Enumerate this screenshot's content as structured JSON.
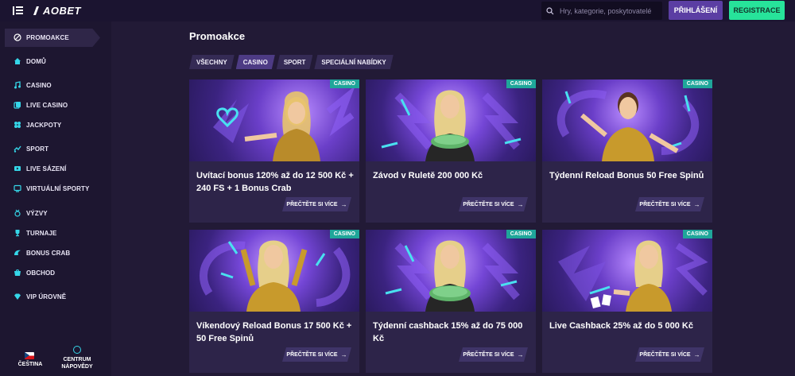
{
  "header": {
    "logo": "AOBET",
    "search_placeholder": "Hry, kategorie, poskytovatelé",
    "login_label": "PŘIHLÁŠENÍ",
    "register_label": "REGISTRACE"
  },
  "sidebar": {
    "items": [
      {
        "label": "PROMOAKCE",
        "icon": "promo-icon"
      },
      {
        "label": "DOMŮ",
        "icon": "home-icon"
      },
      {
        "label": "CASINO",
        "icon": "music-note-icon"
      },
      {
        "label": "LIVE CASINO",
        "icon": "live-casino-icon"
      },
      {
        "label": "JACKPOTY",
        "icon": "clover-icon"
      },
      {
        "label": "SPORT",
        "icon": "sport-icon"
      },
      {
        "label": "LIVE SÁZENÍ",
        "icon": "live-betting-icon"
      },
      {
        "label": "VIRTUÁLNÍ SPORTY",
        "icon": "virtual-sports-icon"
      },
      {
        "label": "VÝZVY",
        "icon": "medal-icon"
      },
      {
        "label": "TURNAJE",
        "icon": "trophy-icon"
      },
      {
        "label": "BONUS CRAB",
        "icon": "crab-icon"
      },
      {
        "label": "OBCHOD",
        "icon": "shop-icon"
      },
      {
        "label": "VIP ÚROVNĚ",
        "icon": "diamond-icon"
      }
    ],
    "language_label": "ČEŠTINA",
    "help_label_line1": "CENTRUM",
    "help_label_line2": "NÁPOVĚDY"
  },
  "main": {
    "title": "Promoakce",
    "tabs": [
      {
        "label": "VŠECHNY"
      },
      {
        "label": "CASINO"
      },
      {
        "label": "SPORT"
      },
      {
        "label": "SPECIÁLNÍ NABÍDKY"
      }
    ],
    "active_tab": "CASINO",
    "read_more_label": "PŘEČTĚTE SI VÍCE",
    "cards": [
      {
        "badge": "CASINO",
        "title": "Uvítací bonus 120% až do 12 500 Kč + 240 FS + 1 Bonus Crab"
      },
      {
        "badge": "CASINO",
        "title": "Závod v Ruletě 200 000 Kč"
      },
      {
        "badge": "CASINO",
        "title": "Týdenní Reload Bonus 50 Free Spinů"
      },
      {
        "badge": "CASINO",
        "title": "Víkendový Reload Bonus 17 500 Kč + 50 Free Spinů"
      },
      {
        "badge": "CASINO",
        "title": "Týdenní cashback 15% až do 75 000 Kč"
      },
      {
        "badge": "CASINO",
        "title": "Live Cashback 25% až do 5 000 Kč"
      }
    ]
  },
  "colors": {
    "background": "#221a36",
    "sidebar": "#1d1630",
    "accent_purple": "#5b3ea3",
    "accent_green": "#27e39a",
    "badge_teal": "#1fa69a",
    "icon_cyan": "#35d6e8"
  }
}
